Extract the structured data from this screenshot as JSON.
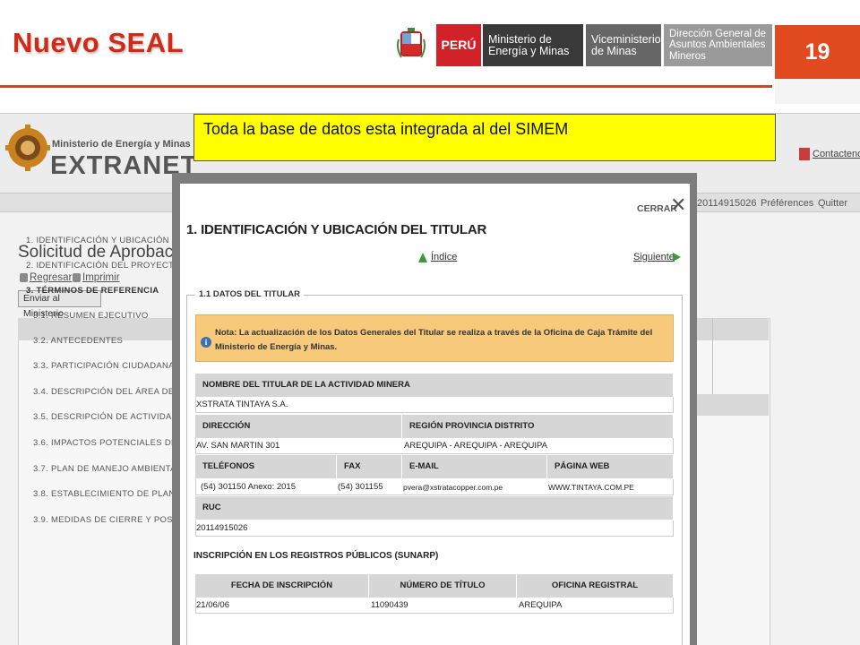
{
  "slide": {
    "title": "Nuevo SEAL",
    "page_number": "19"
  },
  "gov_logo": {
    "country": "PERÚ",
    "ministry": "Ministerio de Energía y Minas",
    "vice_ministry": "Viceministerio de Minas",
    "direction": "Dirección General de Asuntos Ambientales Mineros",
    "crest_caption": "REPÚBLICA DEL PERÚ"
  },
  "callout": {
    "text": "Toda la base de datos esta integrada al del SIMEM"
  },
  "extranet": {
    "brand_ministry": "Ministerio de Energía y Minas",
    "brand_name": "EXTRANET",
    "contact_link": "Contactenos",
    "nav": {
      "user_id": "20114915026",
      "preferences": "Préférences",
      "quit": "Quitter"
    },
    "page_heading": "Solicitud de Aprobación",
    "back_link": "Regresar",
    "print_link": "Imprimir",
    "send_button": "Enviar al Ministerio",
    "index_items": [
      {
        "label": "1. IDENTIFICACIÓN Y UBICACIÓN DEL T",
        "bold": false,
        "sub": false
      },
      {
        "label": "2. IDENTIFICACIÓN DEL PROYECTO",
        "bold": false,
        "sub": false
      },
      {
        "label": "3. TÉRMINOS DE REFERENCIA",
        "bold": true,
        "sub": false
      },
      {
        "label": "3.1. RESUMEN EJECUTIVO",
        "bold": false,
        "sub": true
      },
      {
        "label": "3.2. ANTECEDENTES",
        "bold": false,
        "sub": true
      },
      {
        "label": "3.3. PARTICIPACIÓN CIUDADANA",
        "bold": false,
        "sub": true
      },
      {
        "label": "3.4. DESCRIPCIÓN DEL ÁREA DEL PR",
        "bold": false,
        "sub": true
      },
      {
        "label": "3.5. DESCRIPCIÓN DE ACTIVIDADES",
        "bold": false,
        "sub": true
      },
      {
        "label": "3.6. IMPACTOS POTENCIALES DE LA AC",
        "bold": false,
        "sub": true
      },
      {
        "label": "3.7. PLAN DE MANEJO AMBIENTAL",
        "bold": false,
        "sub": true
      },
      {
        "label": "3.8. ESTABLECIMIENTO DE PLANTAS PI",
        "bold": false,
        "sub": true
      },
      {
        "label": "3.9. MEDIDAS DE CIERRE Y POSTCIER",
        "bold": false,
        "sub": true
      }
    ]
  },
  "modal": {
    "close_label": "CERRAR",
    "title": "1. IDENTIFICACIÓN Y UBICACIÓN DEL TITULAR",
    "index_link": "Índice",
    "next_link": "Siguiente",
    "section_legend": "1.1 DATOS DEL TITULAR",
    "note": "Nota: La actualización de los Datos Generales del Titular se realiza a través de la Oficina de Caja Trámite del Ministerio de Energía y Minas.",
    "holder_name_label": "NOMBRE DEL TITULAR DE LA ACTIVIDAD MINERA",
    "holder_name": "XSTRATA TINTAYA S.A.",
    "address_label": "DIRECCIÓN",
    "address": "AV. SAN MARTIN 301",
    "region_label": "REGIÓN PROVINCIA DISTRITO",
    "region": "AREQUIPA - AREQUIPA - AREQUIPA",
    "phones_label": "TELÉFONOS",
    "phones": "(54) 301150 Anexo: 2015",
    "fax_label": "FAX",
    "fax": "(54) 301155",
    "email_label": "E-MAIL",
    "email": "pvera@xstratacopper.com.pe",
    "web_label": "PÁGINA WEB",
    "web": "WWW.TINTAYA.COM.PE",
    "ruc_label": "RUC",
    "ruc": "20114915026",
    "sunarp_title": "INSCRIPCIÓN EN LOS REGISTROS PÚBLICOS (SUNARP)",
    "reg_date_label": "FECHA DE INSCRIPCIÓN",
    "reg_date": "21/06/06",
    "title_no_label": "NÚMERO DE TÍTULO",
    "title_no": "11090439",
    "office_label": "OFICINA REGISTRAL",
    "office": "AREQUIPA"
  }
}
